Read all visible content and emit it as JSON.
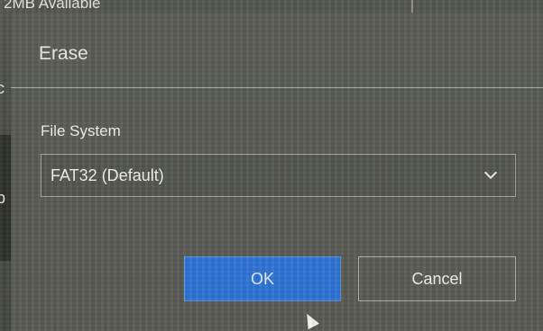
{
  "background": {
    "top_text": "2MB Available",
    "left_letter_1": "c",
    "left_letter_2": "p"
  },
  "dialog": {
    "title": "Erase",
    "field_label": "File System",
    "file_system_select": {
      "selected": "FAT32 (Default)"
    },
    "ok_label": "OK",
    "cancel_label": "Cancel"
  },
  "colors": {
    "ok_button": "#2f74d6",
    "dialog_background": "#5c5f56",
    "text": "#f0f0ee"
  },
  "icons": {
    "dropdown": "chevron-down-icon",
    "pointer": "mouse-cursor-icon"
  }
}
